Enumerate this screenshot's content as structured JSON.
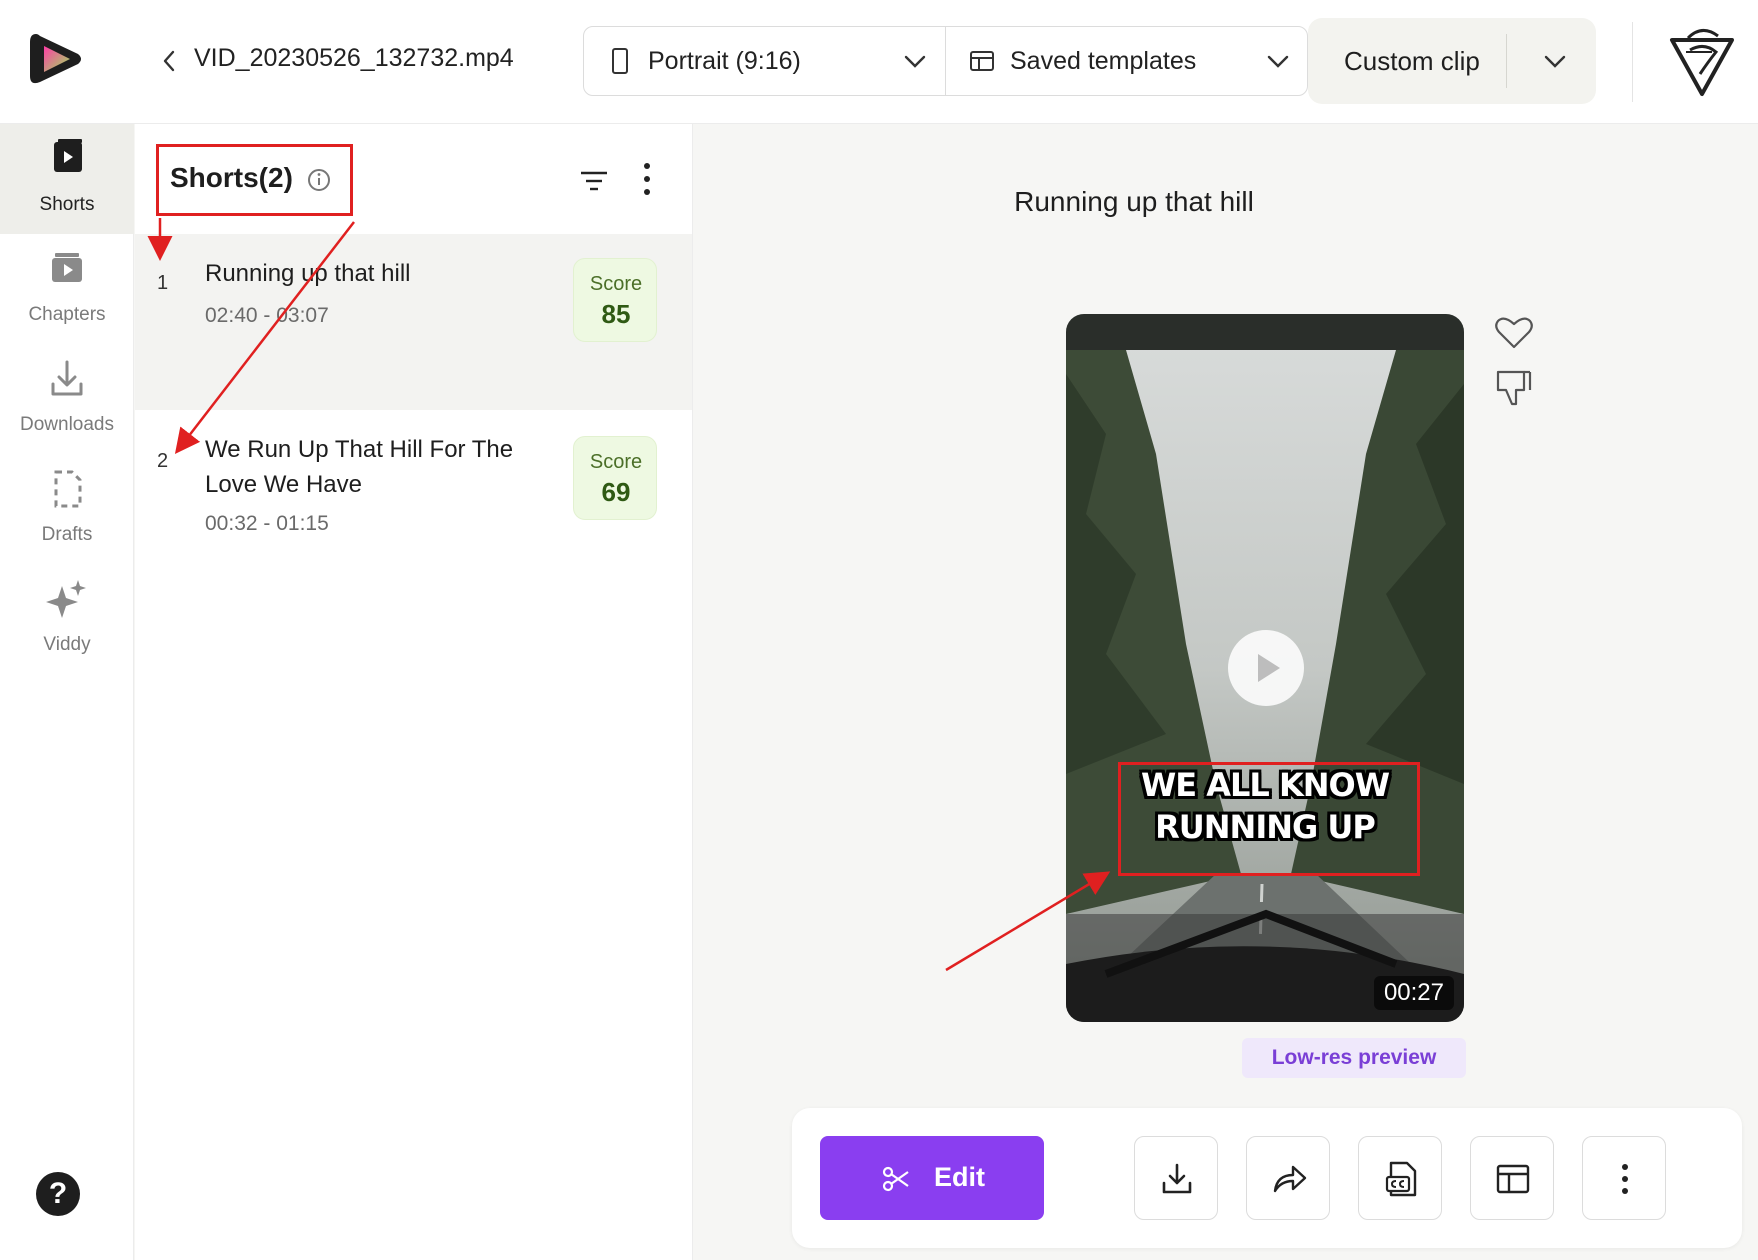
{
  "header": {
    "back_label": "<",
    "filename": "VID_20230526_132732.mp4",
    "aspect_select": "Portrait (9:16)",
    "template_select": "Saved templates",
    "custom_clip": "Custom clip"
  },
  "nav": {
    "items": [
      {
        "label": "Shorts",
        "icon": "shorts-icon",
        "active": true
      },
      {
        "label": "Chapters",
        "icon": "chapters-icon"
      },
      {
        "label": "Downloads",
        "icon": "download-icon"
      },
      {
        "label": "Drafts",
        "icon": "drafts-icon"
      },
      {
        "label": "Viddy",
        "icon": "sparkle-icon"
      }
    ],
    "help": "?"
  },
  "list": {
    "title": "Shorts(2)",
    "items": [
      {
        "num": "1",
        "title": "Running up that hill",
        "time": "02:40 - 03:07",
        "score_label": "Score",
        "score": "85"
      },
      {
        "num": "2",
        "title": "We Run Up That Hill For The Love We Have",
        "time": "00:32 - 01:15",
        "score_label": "Score",
        "score": "69"
      }
    ]
  },
  "preview": {
    "title": "Running up that hill",
    "caption_line1": "WE ALL KNOW",
    "caption_line2": "RUNNING UP",
    "duration": "00:27",
    "lowres": "Low-res preview",
    "edit_label": "Edit"
  },
  "colors": {
    "accent": "#8a3ef0",
    "annotation": "#e02020",
    "score_bg": "#eef9e2"
  }
}
